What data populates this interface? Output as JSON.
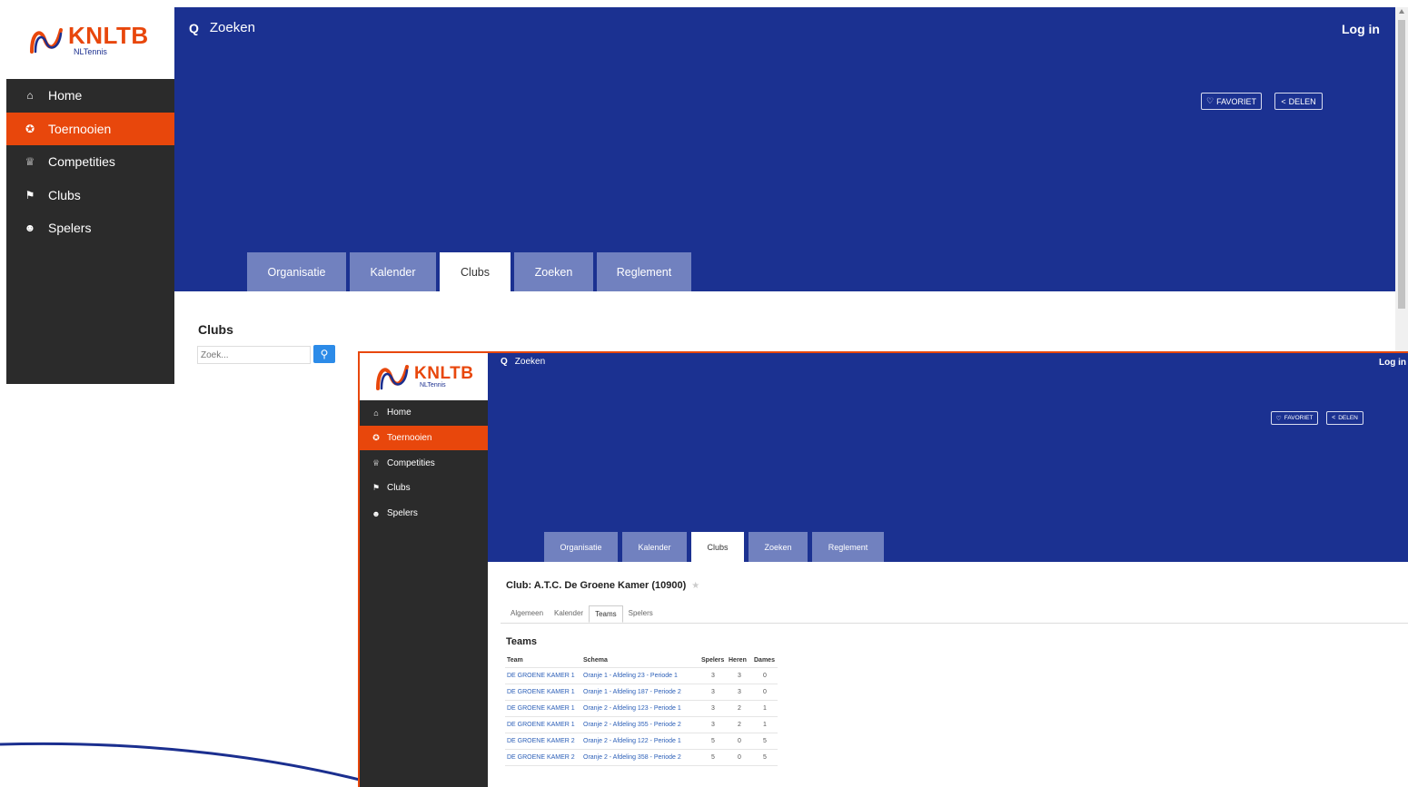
{
  "logo": {
    "brand": "KNLTB",
    "sub": "NLTennis"
  },
  "nav": [
    {
      "label": "Home",
      "icon": "home-icon",
      "glyph": "⌂"
    },
    {
      "label": "Toernooien",
      "icon": "medal-icon",
      "glyph": "ꝏ"
    },
    {
      "label": "Competities",
      "icon": "trophy-icon",
      "glyph": "♆"
    },
    {
      "label": "Clubs",
      "icon": "flag-icon",
      "glyph": "⚑"
    },
    {
      "label": "Spelers",
      "icon": "users-icon",
      "glyph": "☻"
    }
  ],
  "active_nav": "Toernooien",
  "header": {
    "search_label": "Zoeken",
    "login_label": "Log in",
    "favorite_label": "FAVORIET",
    "share_label": "DELEN"
  },
  "tabs": [
    "Organisatie",
    "Kalender",
    "Clubs",
    "Zoeken",
    "Reglement"
  ],
  "active_tab": "Clubs",
  "background_page": {
    "title": "Clubs",
    "search_placeholder": "Zoek..."
  },
  "club_page": {
    "title": "Club: A.T.C. De Groene Kamer (10900)",
    "subtabs": [
      "Algemeen",
      "Kalender",
      "Teams",
      "Spelers"
    ],
    "active_subtab": "Teams",
    "section_title": "Teams",
    "table": {
      "headers": [
        "Team",
        "Schema",
        "Spelers",
        "Heren",
        "Dames"
      ],
      "rows": [
        [
          "DE GROENE KAMER 1",
          "Oranje 1 - Afdeling 23 - Periode 1",
          "3",
          "3",
          "0"
        ],
        [
          "DE GROENE KAMER 1",
          "Oranje 1 - Afdeling 187 - Periode 2",
          "3",
          "3",
          "0"
        ],
        [
          "DE GROENE KAMER 1",
          "Oranje 2 - Afdeling 123 - Periode 1",
          "3",
          "2",
          "1"
        ],
        [
          "DE GROENE KAMER 1",
          "Oranje 2 - Afdeling 355 - Periode 2",
          "3",
          "2",
          "1"
        ],
        [
          "DE GROENE KAMER 2",
          "Oranje 2 - Afdeling 122 - Periode 1",
          "5",
          "0",
          "5"
        ],
        [
          "DE GROENE KAMER 2",
          "Oranje 2 - Afdeling 358 - Periode 2",
          "5",
          "0",
          "5"
        ]
      ]
    }
  },
  "colors": {
    "brand_orange": "#e8470c",
    "header_blue": "#1b3191",
    "tab_inactive": "#7181bf",
    "sidebar_dark": "#2b2b2b",
    "link_blue": "#2d60b8"
  }
}
